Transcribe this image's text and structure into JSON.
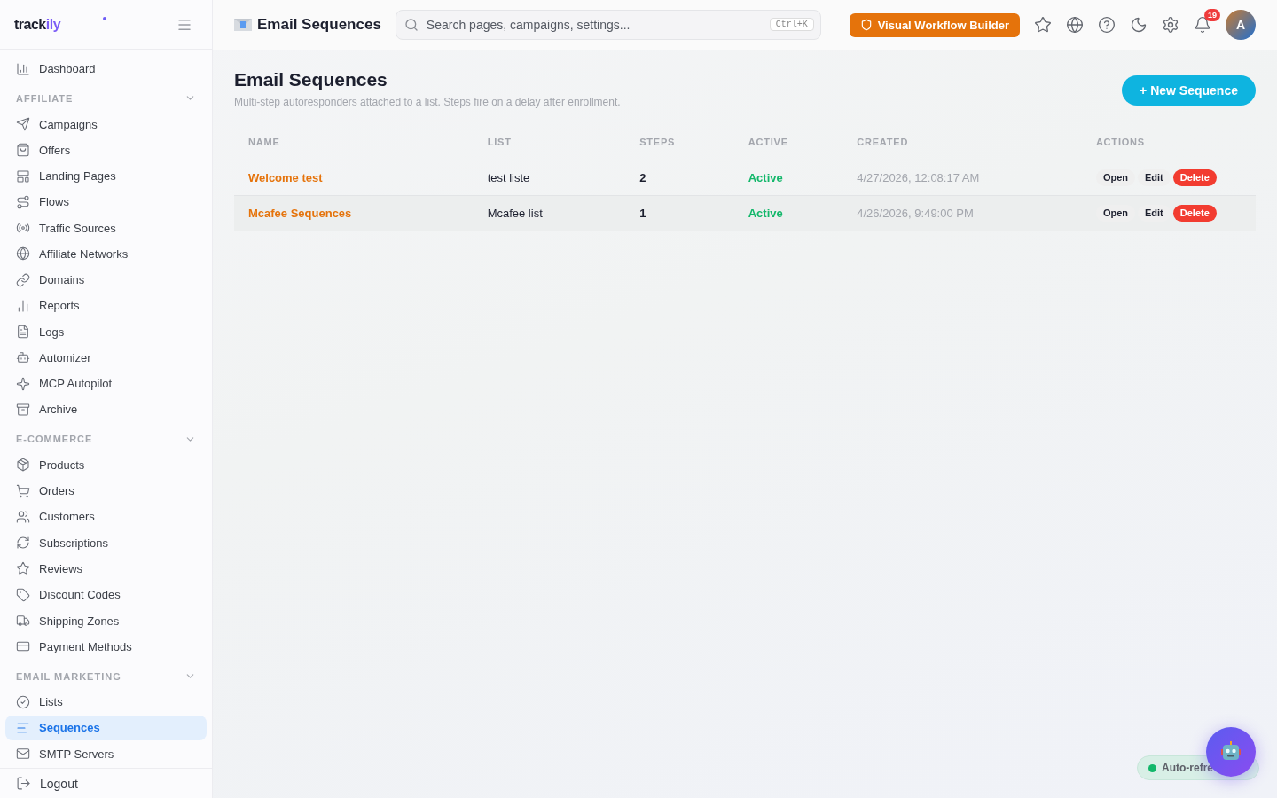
{
  "brand": {
    "name": "track",
    "accent": "ily"
  },
  "sidebar": {
    "top_items": [
      {
        "label": "Dashboard",
        "selected": false
      }
    ],
    "sections": [
      {
        "title": "AFFILIATE",
        "expanded": true,
        "items": [
          {
            "label": "Campaigns",
            "selected": false
          },
          {
            "label": "Offers",
            "selected": false
          },
          {
            "label": "Landing Pages",
            "selected": false
          },
          {
            "label": "Flows",
            "selected": false
          },
          {
            "label": "Traffic Sources",
            "selected": false
          },
          {
            "label": "Affiliate Networks",
            "selected": false
          },
          {
            "label": "Domains",
            "selected": false
          },
          {
            "label": "Reports",
            "selected": false
          },
          {
            "label": "Logs",
            "selected": false
          },
          {
            "label": "Automizer",
            "selected": false
          },
          {
            "label": "MCP Autopilot",
            "selected": false
          },
          {
            "label": "Archive",
            "selected": false
          }
        ]
      },
      {
        "title": "E-COMMERCE",
        "expanded": true,
        "items": [
          {
            "label": "Products",
            "selected": false
          },
          {
            "label": "Orders",
            "selected": false
          },
          {
            "label": "Customers",
            "selected": false
          },
          {
            "label": "Subscriptions",
            "selected": false
          },
          {
            "label": "Reviews",
            "selected": false
          },
          {
            "label": "Discount Codes",
            "selected": false
          },
          {
            "label": "Shipping Zones",
            "selected": false
          },
          {
            "label": "Payment Methods",
            "selected": false
          }
        ]
      },
      {
        "title": "EMAIL MARKETING",
        "expanded": true,
        "items": [
          {
            "label": "Lists",
            "selected": false
          },
          {
            "label": "Sequences",
            "selected": true
          },
          {
            "label": "SMTP Servers",
            "selected": false
          }
        ]
      }
    ],
    "logout": "Logout"
  },
  "topbar": {
    "title": "Email Sequences",
    "search": {
      "placeholder": "Search pages, campaigns, settings...",
      "shortcut": "Ctrl+K"
    },
    "workflow_button": "Visual Workflow Builder",
    "notifications": "19",
    "avatar": "A"
  },
  "page": {
    "title": "Email Sequences",
    "subtitle": "Multi-step autoresponders attached to a list. Steps fire on a delay after enrollment.",
    "new_button": "+ New Sequence"
  },
  "table": {
    "columns": [
      "NAME",
      "LIST",
      "STEPS",
      "ACTIVE",
      "CREATED",
      "ACTIONS"
    ],
    "rows": [
      {
        "name": "Welcome test",
        "list": "test liste",
        "steps": "2",
        "active": true,
        "status": "Active",
        "created": "4/27/2026, 12:08:17 AM",
        "actions": [
          "Open",
          "Edit",
          "Delete"
        ]
      },
      {
        "name": "Mcafee Sequences",
        "list": "Mcafee list",
        "steps": "1",
        "active": true,
        "status": "Active",
        "created": "4/26/2026, 9:49:00 PM",
        "actions": [
          "Open",
          "Edit",
          "Delete"
        ]
      }
    ]
  },
  "auto_refresh": {
    "label": "Auto-refre",
    "on": true
  }
}
